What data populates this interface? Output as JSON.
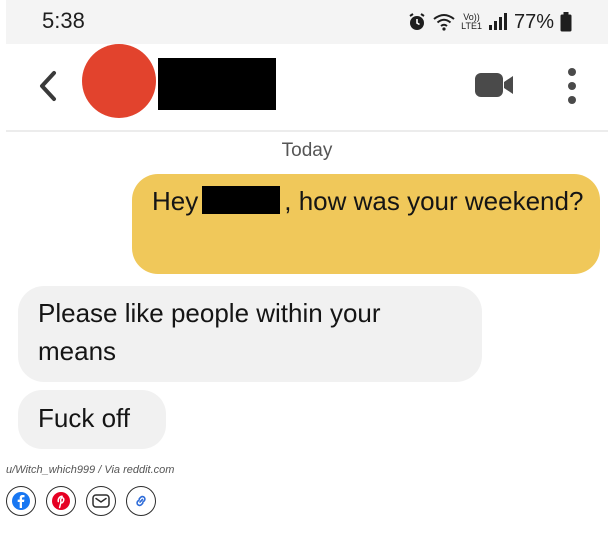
{
  "status_bar": {
    "time": "5:38",
    "volte_top": "Vo))",
    "volte_bottom": "LTE1",
    "battery": "77%",
    "icons": [
      "alarm-icon",
      "wifi-icon",
      "signal-icon",
      "battery-icon"
    ]
  },
  "header": {
    "icons": [
      "back-icon",
      "video-call-icon",
      "more-icon"
    ],
    "avatar_color": "#e2432d"
  },
  "conversation": {
    "day_label": "Today",
    "messages": [
      {
        "side": "sent",
        "before": "Hey",
        "after": ", how was your weekend?"
      },
      {
        "side": "received",
        "text": "Please like people within your means"
      },
      {
        "side": "received",
        "text": "Fuck off"
      }
    ]
  },
  "credit": "u/Witch_which999 / Via reddit.com",
  "share": {
    "icons": [
      "facebook-icon",
      "pinterest-icon",
      "email-icon",
      "link-icon"
    ],
    "colors": {
      "facebook": "#1877f2",
      "pinterest": "#e60023"
    }
  },
  "colors": {
    "sent_bubble": "#f0c85a",
    "received_bubble": "#f1f1f1"
  }
}
